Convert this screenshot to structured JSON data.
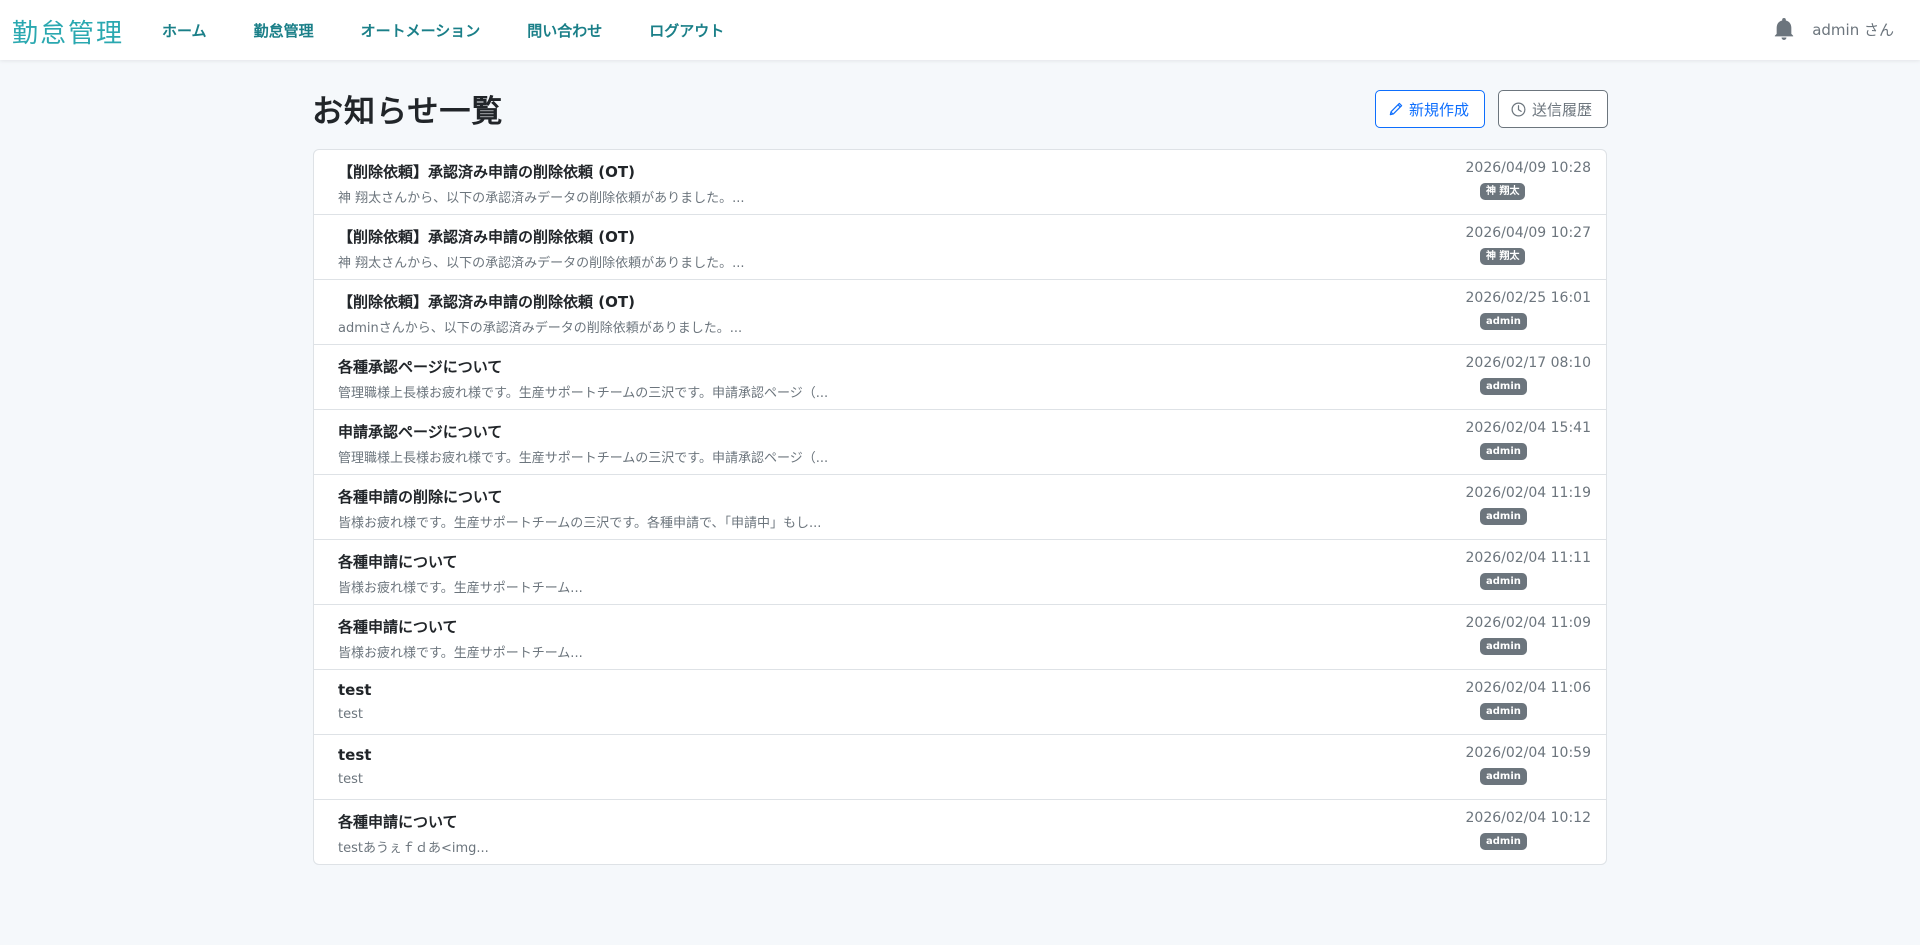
{
  "nav": {
    "brand": "勤怠管理",
    "links": [
      "ホーム",
      "勤怠管理",
      "オートメーション",
      "問い合わせ",
      "ログアウト"
    ],
    "user": "admin さん"
  },
  "page": {
    "title": "お知らせ一覧",
    "new_button": "新規作成",
    "history_button": "送信履歴"
  },
  "notices": [
    {
      "title": "【削除依頼】承認済み申請の削除依頼 (OT)",
      "preview": "神 翔太さんから、以下の承認済みデータの削除依頼がありました。...",
      "date": "2026/04/09 10:28",
      "author": "神 翔太"
    },
    {
      "title": "【削除依頼】承認済み申請の削除依頼 (OT)",
      "preview": "神 翔太さんから、以下の承認済みデータの削除依頼がありました。...",
      "date": "2026/04/09 10:27",
      "author": "神 翔太"
    },
    {
      "title": "【削除依頼】承認済み申請の削除依頼 (OT)",
      "preview": "adminさんから、以下の承認済みデータの削除依頼がありました。...",
      "date": "2026/02/25 16:01",
      "author": "admin"
    },
    {
      "title": "各種承認ページについて",
      "preview": "管理職様上長様お疲れ様です。生産サポートチームの三沢です。申請承認ページ（...",
      "date": "2026/02/17 08:10",
      "author": "admin"
    },
    {
      "title": "申請承認ページについて",
      "preview": "管理職様上長様お疲れ様です。生産サポートチームの三沢です。申請承認ページ（...",
      "date": "2026/02/04 15:41",
      "author": "admin"
    },
    {
      "title": "各種申請の削除について",
      "preview": "皆様お疲れ様です。生産サポートチームの三沢です。各種申請で、「申請中」もし...",
      "date": "2026/02/04 11:19",
      "author": "admin"
    },
    {
      "title": "各種申請について",
      "preview": "皆様お疲れ様です。生産サポートチーム...",
      "date": "2026/02/04 11:11",
      "author": "admin"
    },
    {
      "title": "各種申請について",
      "preview": "皆様お疲れ様です。生産サポートチーム...",
      "date": "2026/02/04 11:09",
      "author": "admin"
    },
    {
      "title": "test",
      "preview": "test",
      "date": "2026/02/04 11:06",
      "author": "admin"
    },
    {
      "title": "test",
      "preview": "test",
      "date": "2026/02/04 10:59",
      "author": "admin"
    },
    {
      "title": "各種申請について",
      "preview": "testあうぇｆｄあ<img...",
      "date": "2026/02/04 10:12",
      "author": "admin"
    }
  ]
}
